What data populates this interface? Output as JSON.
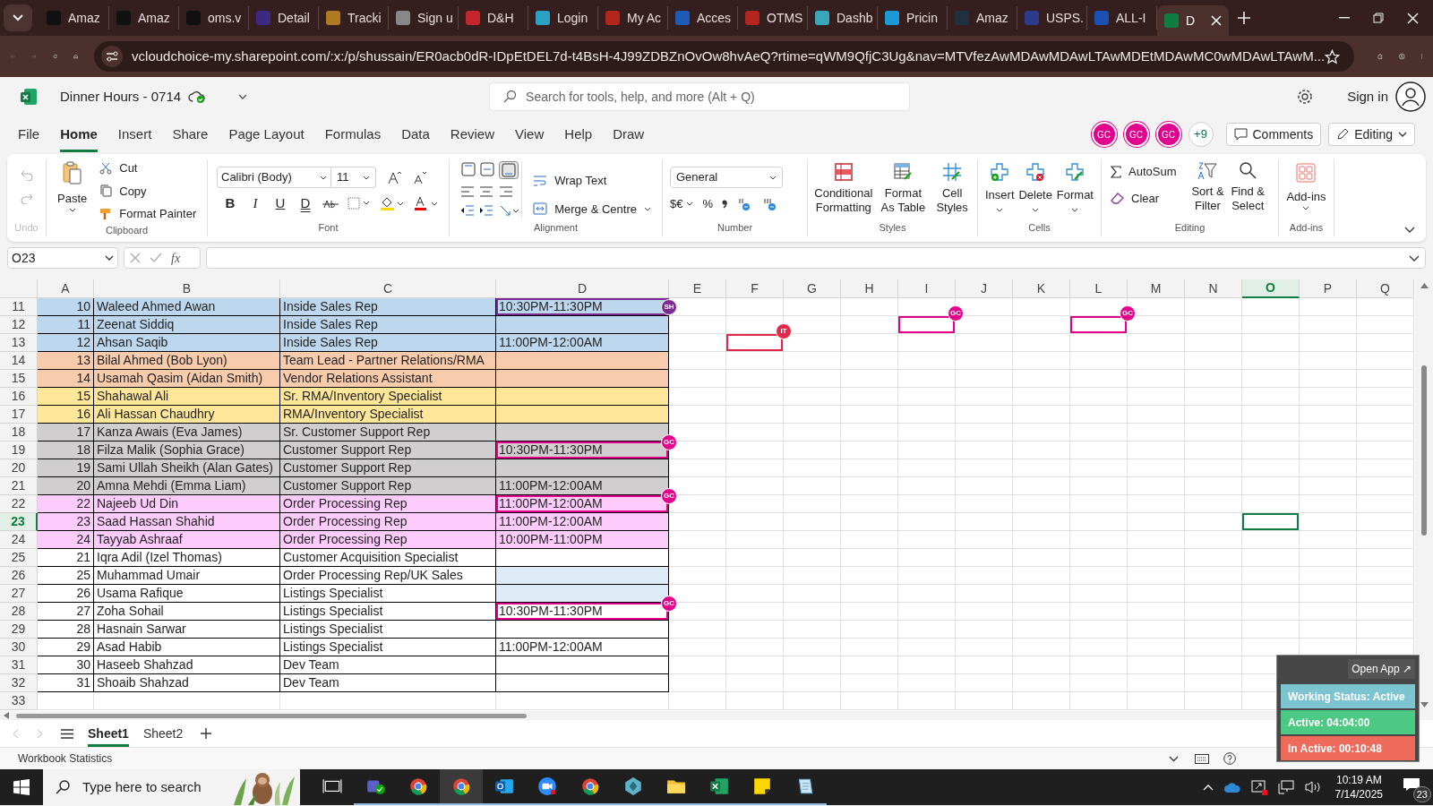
{
  "browser": {
    "tabs": [
      {
        "title": "Amaz",
        "selected": false
      },
      {
        "title": "Amaz",
        "selected": false
      },
      {
        "title": "oms.v",
        "selected": false
      },
      {
        "title": "Detail",
        "selected": false
      },
      {
        "title": "Tracki",
        "selected": false
      },
      {
        "title": "Sign u",
        "selected": false
      },
      {
        "title": "D&H",
        "selected": false
      },
      {
        "title": "Login",
        "selected": false
      },
      {
        "title": "My Ac",
        "selected": false
      },
      {
        "title": "Acces",
        "selected": false
      },
      {
        "title": "OTMS",
        "selected": false
      },
      {
        "title": "Dashb",
        "selected": false
      },
      {
        "title": "Pricin",
        "selected": false
      },
      {
        "title": "Amaz",
        "selected": false
      },
      {
        "title": "USPS.",
        "selected": false
      },
      {
        "title": "ALL-I",
        "selected": false
      },
      {
        "title": "D",
        "selected": true
      }
    ],
    "url": "vcloudchoice-my.sharepoint.com/:x:/p/shussain/ER0acb0dR-IDpEtDEL7d-t4BsH-4J99ZDBZnOvOw8hvAeQ?rtime=qWM9QfjC3Ug&nav=MTVfezAwMDAwMDAwLTAwMDEtMDAwMC0wMDAwLTAwM..."
  },
  "app": {
    "doc_title": "Dinner Hours - 0714",
    "search_placeholder": "Search for tools, help, and more (Alt + Q)",
    "sign_in": "Sign in",
    "menu": [
      {
        "label": "File",
        "selected": false
      },
      {
        "label": "Home",
        "selected": true
      },
      {
        "label": "Insert",
        "selected": false
      },
      {
        "label": "Share",
        "selected": false
      },
      {
        "label": "Page Layout",
        "selected": false
      },
      {
        "label": "Formulas",
        "selected": false
      },
      {
        "label": "Data",
        "selected": false
      },
      {
        "label": "Review",
        "selected": false
      },
      {
        "label": "View",
        "selected": false
      },
      {
        "label": "Help",
        "selected": false
      },
      {
        "label": "Draw",
        "selected": false
      }
    ],
    "collaborators": [
      "GC",
      "GC",
      "GC"
    ],
    "more_collaborators": "+9",
    "comments": "Comments",
    "mode": "Editing"
  },
  "ribbon": {
    "undo": "Undo",
    "paste": "Paste",
    "cut": "Cut",
    "copy": "Copy",
    "format_painter": "Format Painter",
    "clipboard": "Clipboard",
    "font_name": "Calibri (Body)",
    "font_size": "11",
    "font_buttons": [
      "B",
      "I",
      "U",
      "D"
    ],
    "font": "Font",
    "wrap_text": "Wrap Text",
    "merge": "Merge & Centre",
    "alignment": "Alignment",
    "number_format": "General",
    "currency": "$€",
    "percent": "%",
    "number": "Number",
    "conditional": "Conditional Formatting",
    "format_table": "Format As Table",
    "cell_styles": "Cell Styles",
    "styles": "Styles",
    "insert": "Insert",
    "delete": "Delete",
    "format": "Format",
    "cells": "Cells",
    "autosum": "AutoSum",
    "clear": "Clear",
    "sort": "Sort & Filter",
    "find": "Find & Select",
    "editing": "Editing",
    "addins_button": "Add-ins",
    "addins": "Add-ins"
  },
  "formula_bar": {
    "name_box": "O23",
    "fx": "fx"
  },
  "sheet": {
    "columns": [
      {
        "label": "A",
        "selected": false
      },
      {
        "label": "B",
        "selected": false
      },
      {
        "label": "C",
        "selected": false
      },
      {
        "label": "D",
        "selected": false
      },
      {
        "label": "E",
        "selected": false
      },
      {
        "label": "F",
        "selected": false
      },
      {
        "label": "G",
        "selected": false
      },
      {
        "label": "H",
        "selected": false
      },
      {
        "label": "I",
        "selected": false
      },
      {
        "label": "J",
        "selected": false
      },
      {
        "label": "K",
        "selected": false
      },
      {
        "label": "L",
        "selected": false
      },
      {
        "label": "M",
        "selected": false
      },
      {
        "label": "N",
        "selected": false
      },
      {
        "label": "O",
        "selected": true
      },
      {
        "label": "P",
        "selected": false
      },
      {
        "label": "Q",
        "selected": false
      }
    ],
    "rows": [
      {
        "label": "11",
        "selected": false,
        "color": "#bdd7ee",
        "cells": [
          {
            "text": "10"
          },
          {
            "text": "Waleed Ahmed Awan"
          },
          {
            "text": "Inside Sales Rep"
          },
          {
            "text": "10:30PM-11:30PM",
            "cursor": {
              "initials": "SH",
              "color": "#7b2a8f"
            }
          }
        ]
      },
      {
        "label": "12",
        "selected": false,
        "color": "#bdd7ee",
        "cells": [
          {
            "text": "11"
          },
          {
            "text": "Zeenat Siddiq"
          },
          {
            "text": "Inside Sales Rep"
          }
        ],
        "cursors": [
          {
            "initials": "GC",
            "color": "#e3008c"
          },
          {
            "initials": "GC",
            "color": "#e3008c"
          }
        ]
      },
      {
        "label": "13",
        "selected": false,
        "color": "#bdd7ee",
        "cells": [
          {
            "text": "12"
          },
          {
            "text": "Ahsan Saqib"
          },
          {
            "text": "Inside Sales Rep"
          },
          {
            "text": "11:00PM-12:00AM"
          }
        ],
        "cursors": [
          {
            "initials": "IT",
            "color": "#e3264a"
          }
        ]
      },
      {
        "label": "14",
        "selected": false,
        "color": "#f8cbad",
        "cells": [
          {
            "text": "13"
          },
          {
            "text": "Bilal Ahmed (Bob Lyon)"
          },
          {
            "text": "Team Lead - Partner Relations/RMA"
          }
        ]
      },
      {
        "label": "15",
        "selected": false,
        "color": "#f8cbad",
        "cells": [
          {
            "text": "14"
          },
          {
            "text": "Usamah Qasim (Aidan Smith)"
          },
          {
            "text": "Vendor Relations Assistant"
          }
        ]
      },
      {
        "label": "16",
        "selected": false,
        "color": "#ffe699",
        "cells": [
          {
            "text": "15"
          },
          {
            "text": "Shahawal Ali"
          },
          {
            "text": "Sr. RMA/Inventory Specialist"
          }
        ]
      },
      {
        "label": "17",
        "selected": false,
        "color": "#ffe699",
        "cells": [
          {
            "text": "16"
          },
          {
            "text": "Ali Hassan Chaudhry"
          },
          {
            "text": "RMA/Inventory Specialist"
          }
        ]
      },
      {
        "label": "18",
        "selected": false,
        "color": "#d0cece",
        "cells": [
          {
            "text": "17"
          },
          {
            "text": "Kanza Awais (Eva James)"
          },
          {
            "text": "Sr. Customer Support Rep"
          }
        ]
      },
      {
        "label": "19",
        "selected": false,
        "color": "#d0cece",
        "cells": [
          {
            "text": "18"
          },
          {
            "text": "Filza Malik (Sophia Grace)"
          },
          {
            "text": "Customer Support Rep"
          },
          {
            "text": "10:30PM-11:30PM",
            "cursor": {
              "initials": "GC",
              "color": "#e3008c"
            }
          }
        ]
      },
      {
        "label": "20",
        "selected": false,
        "color": "#d0cece",
        "cells": [
          {
            "text": "19"
          },
          {
            "text": "Sami Ullah Sheikh (Alan Gates)"
          },
          {
            "text": "Customer Support Rep"
          }
        ]
      },
      {
        "label": "21",
        "selected": false,
        "color": "#d0cece",
        "cells": [
          {
            "text": "20"
          },
          {
            "text": "Amna Mehdi (Emma Liam)"
          },
          {
            "text": "Customer Support Rep"
          },
          {
            "text": "11:00PM-12:00AM"
          }
        ]
      },
      {
        "label": "22",
        "selected": false,
        "color": "#fdccfd",
        "cells": [
          {
            "text": "22"
          },
          {
            "text": "Najeeb Ud Din"
          },
          {
            "text": "Order Processing Rep"
          },
          {
            "text": "11:00PM-12:00AM",
            "cursor": {
              "initials": "GC",
              "color": "#e3008c"
            }
          }
        ]
      },
      {
        "label": "23",
        "selected": true,
        "color": "#fdccfd",
        "cells": [
          {
            "text": "23"
          },
          {
            "text": "Saad Hassan Shahid"
          },
          {
            "text": "Order Processing Rep"
          },
          {
            "text": "11:00PM-12:00AM"
          }
        ]
      },
      {
        "label": "24",
        "selected": false,
        "color": "#fdccfd",
        "cells": [
          {
            "text": "24"
          },
          {
            "text": "Tayyab Ashraaf"
          },
          {
            "text": "Order Processing Rep"
          },
          {
            "text": "10:00PM-11:00PM"
          }
        ]
      },
      {
        "label": "25",
        "selected": false,
        "color": "#ffffff",
        "cells": [
          {
            "text": "21"
          },
          {
            "text": "Iqra Adil (Izel Thomas)"
          },
          {
            "text": "Customer Acquisition Specialist"
          }
        ]
      },
      {
        "label": "26",
        "selected": false,
        "color": "#ffffff",
        "cells": [
          {
            "text": "25"
          },
          {
            "text": "Muhammad Umair"
          },
          {
            "text": "Order Processing Rep/UK Sales"
          },
          {
            "color": "#ddebf7"
          }
        ]
      },
      {
        "label": "27",
        "selected": false,
        "color": "#ffffff",
        "cells": [
          {
            "text": "26"
          },
          {
            "text": "Usama Rafique"
          },
          {
            "text": "Listings Specialist"
          },
          {
            "color": "#ddebf7"
          }
        ]
      },
      {
        "label": "28",
        "selected": false,
        "color": "#ffffff",
        "cells": [
          {
            "text": "27"
          },
          {
            "text": "Zoha Sohail"
          },
          {
            "text": "Listings Specialist"
          },
          {
            "text": "10:30PM-11:30PM",
            "cursor": {
              "initials": "GC",
              "color": "#e3008c"
            }
          }
        ]
      },
      {
        "label": "29",
        "selected": false,
        "color": "#ffffff",
        "cells": [
          {
            "text": "28"
          },
          {
            "text": "Hasnain Sarwar"
          },
          {
            "text": "Listings Specialist"
          }
        ]
      },
      {
        "label": "30",
        "selected": false,
        "color": "#ffffff",
        "cells": [
          {
            "text": "29"
          },
          {
            "text": "Asad Habib"
          },
          {
            "text": "Listings Specialist"
          },
          {
            "text": "11:00PM-12:00AM"
          }
        ]
      },
      {
        "label": "31",
        "selected": false,
        "color": "#ffffff",
        "cells": [
          {
            "text": "30"
          },
          {
            "text": "Haseeb Shahzad"
          },
          {
            "text": "Dev Team"
          }
        ]
      },
      {
        "label": "32",
        "selected": false,
        "color": "#ffffff",
        "cells": [
          {
            "text": "31"
          },
          {
            "text": "Shoaib Shahzad"
          },
          {
            "text": "Dev Team"
          }
        ]
      },
      {
        "label": "33",
        "selected": false
      }
    ]
  },
  "sheet_tabs": [
    {
      "label": "Sheet1",
      "selected": true
    },
    {
      "label": "Sheet2",
      "selected": false
    }
  ],
  "status_bar": {
    "label": "Workbook Statistics"
  },
  "widget": {
    "open_app": "Open App ↗",
    "statuses": [
      {
        "text": "Working Status: Active",
        "color": "#7cc4cf"
      },
      {
        "text": "Active: 04:04:00",
        "color": "#4cc985"
      },
      {
        "text": "In Active: 00:10:48",
        "color": "#ee6b5c"
      }
    ]
  },
  "taskbar": {
    "search_placeholder": "Type here to search",
    "time": "10:19 AM",
    "date": "7/14/2025",
    "notifications": "23"
  }
}
